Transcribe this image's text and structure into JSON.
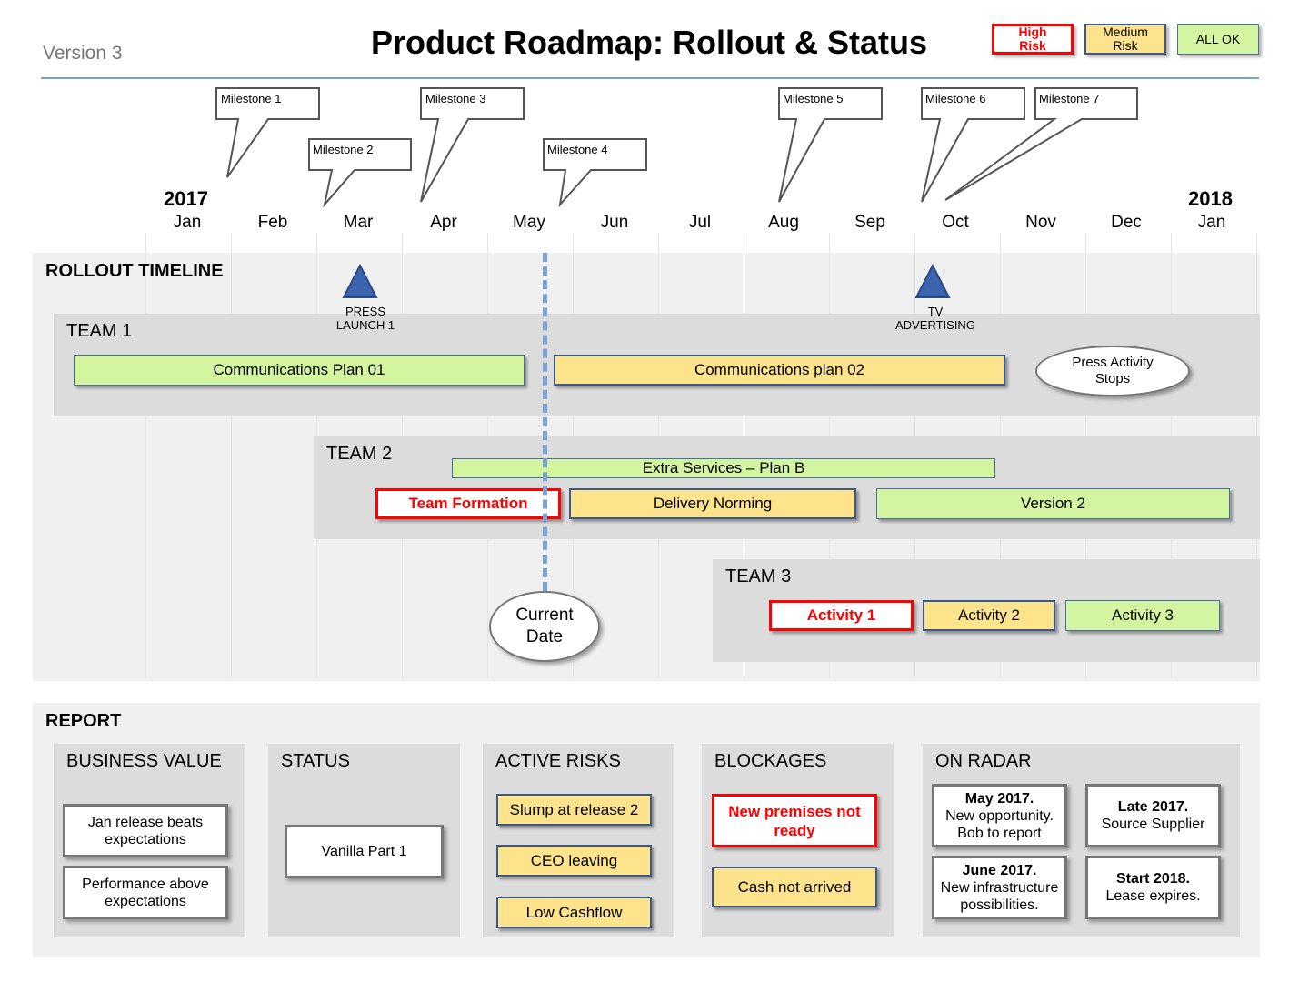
{
  "header": {
    "version": "Version 3",
    "title": "Product Roadmap: Rollout & Status"
  },
  "legend": {
    "high": "High Risk",
    "medium": "Medium Risk",
    "ok": "ALL OK"
  },
  "colors": {
    "high": "#ff0000",
    "medium": "#fde38c",
    "ok": "#d4f5a0",
    "accent": "#4a7cc0",
    "marker": "#3b64b0"
  },
  "milestones": [
    "Milestone  1",
    "Milestone  2",
    "Milestone  3",
    "Milestone  4",
    "Milestone  5",
    "Milestone  6",
    "Milestone  7"
  ],
  "timeline": {
    "year_start": "2017",
    "year_end": "2018",
    "months": [
      "Jan",
      "Feb",
      "Mar",
      "Apr",
      "May",
      "Jun",
      "Jul",
      "Aug",
      "Sep",
      "Oct",
      "Nov",
      "Dec",
      "Jan"
    ]
  },
  "rollout": {
    "title": "ROLLOUT TIMELINE",
    "markers": [
      {
        "line1": "PRESS",
        "line2": "LAUNCH  1"
      },
      {
        "line1": "TV",
        "line2": "ADVERTISING"
      }
    ],
    "current_date": {
      "line1": "Current",
      "line2": "Date"
    },
    "team1": {
      "label": "TEAM 1",
      "items": [
        "Communications  Plan 01",
        "Communications  plan 02"
      ],
      "note": {
        "line1": "Press Activity",
        "line2": "Stops"
      }
    },
    "team2": {
      "label": "TEAM 2",
      "items": [
        "Extra Services – Plan B",
        "Team Formation",
        "Delivery Norming",
        "Version 2"
      ]
    },
    "team3": {
      "label": "TEAM 3",
      "items": [
        "Activity 1",
        "Activity 2",
        "Activity 3"
      ]
    }
  },
  "report": {
    "title": "REPORT",
    "business_value": {
      "label": "BUSINESS  VALUE",
      "items": [
        [
          "Jan release beats",
          "expectations"
        ],
        [
          "Performance above",
          "expectations"
        ]
      ]
    },
    "status": {
      "label": "STATUS",
      "items": [
        "Vanilla Part 1"
      ]
    },
    "active_risks": {
      "label": "ACTIVE RISKS",
      "items": [
        "Slump at release 2",
        "CEO leaving",
        "Low Cashflow"
      ]
    },
    "blockages": {
      "label": "BLOCKAGES",
      "items": [
        [
          "New premises not",
          "ready"
        ],
        "Cash not arrived"
      ]
    },
    "on_radar": {
      "label": "ON RADAR",
      "items": [
        {
          "head": "May 2017.",
          "l1": "New opportunity.",
          "l2": "Bob to report"
        },
        {
          "head": "Late 2017.",
          "l1": "Source Supplier"
        },
        {
          "head": "June 2017.",
          "l1": "New infrastructure",
          "l2": "possibilities."
        },
        {
          "head": "Start 2018.",
          "l1": "Lease expires."
        }
      ]
    }
  }
}
